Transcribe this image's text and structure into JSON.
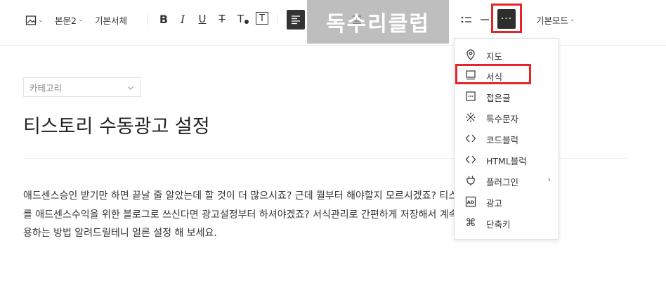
{
  "toolbar": {
    "image_icon": "image-icon",
    "paragraph_style": "본문2",
    "font_face": "기본서체",
    "bold": "B",
    "italic": "I",
    "underline": "U",
    "strike": "T",
    "text_color": "T",
    "text_bg": "T",
    "more": "···",
    "mode": "기본모드"
  },
  "watermark": "독수리클럽",
  "editor": {
    "category_placeholder": "카테고리",
    "title": "티스토리 수동광고 설정",
    "body_lines": [
      "애드센스승인 받기만 하면 끝날 줄 알았는데 할 것이 더 많으시죠? 근데 뭘부터 해야할지 모르시겠죠? 티스토리",
      "를 애드센스수익을 위한 블로그로 쓰신다면 광고설정부터 하셔야겠죠? 서식관리로 간편하게 저장해서 계속 재활",
      "용하는 방법 알려드릴테니 얼른 설정 해 보세요."
    ]
  },
  "menu": {
    "items": [
      {
        "label": "지도",
        "icon": "map-pin-icon"
      },
      {
        "label": "서식",
        "icon": "template-icon"
      },
      {
        "label": "접은글",
        "icon": "fold-icon"
      },
      {
        "label": "특수문자",
        "icon": "special-char-icon"
      },
      {
        "label": "코드블럭",
        "icon": "code-icon"
      },
      {
        "label": "HTML블럭",
        "icon": "html-icon"
      },
      {
        "label": "플러그인",
        "icon": "plugin-icon",
        "submenu": "›"
      },
      {
        "label": "광고",
        "icon": "ad-icon"
      },
      {
        "label": "단축키",
        "icon": "shortcut-icon"
      }
    ]
  },
  "colors": {
    "highlight": "#e8232a",
    "active_button": "#2e2e2e"
  }
}
